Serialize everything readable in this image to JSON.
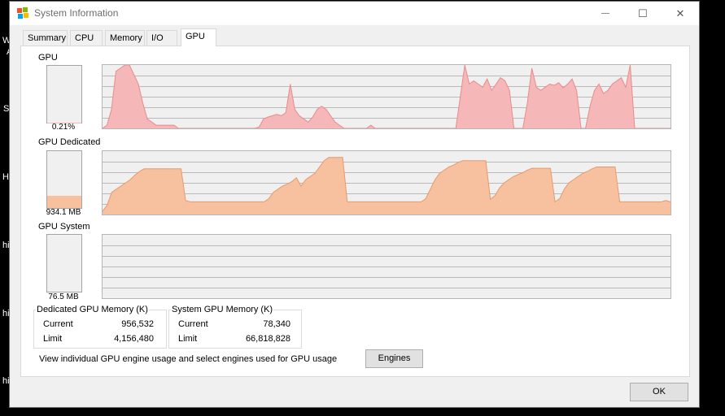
{
  "background_fragments": [
    "W",
    "A",
    "S",
    "H",
    "hi",
    "hi",
    "hi"
  ],
  "window": {
    "title": "System Information",
    "minimize_glyph": "—",
    "maximize_glyph": "☐",
    "close_glyph": "✕"
  },
  "tabs": [
    {
      "label": "Summary"
    },
    {
      "label": "CPU"
    },
    {
      "label": "Memory"
    },
    {
      "label": "I/O"
    },
    {
      "label": "GPU",
      "active": true
    }
  ],
  "sections": {
    "gpu": {
      "label": "GPU",
      "meter_value": "0.21%",
      "meter_fraction": 0.0021
    },
    "gpu_dedicated": {
      "label": "GPU Dedicated",
      "meter_value": "934.1 MB",
      "meter_fraction": 0.22
    },
    "gpu_system": {
      "label": "GPU System",
      "meter_value": "76.5 MB",
      "meter_fraction": 0.0
    }
  },
  "dedicated_memory": {
    "title": "Dedicated GPU Memory (K)",
    "current_label": "Current",
    "current": "956,532",
    "limit_label": "Limit",
    "limit": "4,156,480"
  },
  "system_memory": {
    "title": "System GPU Memory (K)",
    "current_label": "Current",
    "current": "78,340",
    "limit_label": "Limit",
    "limit": "66,818,828"
  },
  "engines_text": "View individual GPU engine usage and select engines used for GPU usage",
  "engines_button": "Engines",
  "ok_button": "OK",
  "colors": {
    "gpu_fill": "#f5b7b7",
    "gpu_line": "#e88c8c",
    "dedicated_fill": "#f7c09f",
    "dedicated_line": "#e59a6e",
    "graph_bg": "#f0f0f0",
    "grid": "#b9b9b9"
  },
  "graphs": {
    "gpu": [
      0,
      5,
      30,
      90,
      95,
      100,
      100,
      85,
      70,
      40,
      15,
      10,
      5,
      5,
      5,
      5,
      5,
      0,
      0,
      0,
      0,
      0,
      0,
      0,
      0,
      0,
      0,
      0,
      0,
      0,
      0,
      0,
      0,
      0,
      0,
      2,
      15,
      18,
      20,
      22,
      20,
      25,
      70,
      30,
      20,
      15,
      10,
      18,
      30,
      35,
      30,
      20,
      10,
      5,
      0,
      0,
      0,
      0,
      0,
      0,
      5,
      0,
      0,
      0,
      0,
      0,
      0,
      0,
      0,
      0,
      0,
      0,
      0,
      0,
      0,
      0,
      0,
      0,
      0,
      0,
      50,
      100,
      70,
      75,
      70,
      65,
      78,
      60,
      70,
      80,
      75,
      60,
      0,
      0,
      0,
      40,
      95,
      65,
      60,
      65,
      70,
      68,
      72,
      64,
      70,
      78,
      60,
      0,
      0,
      35,
      60,
      70,
      55,
      60,
      70,
      75,
      80,
      65,
      100,
      0,
      0,
      0,
      0,
      0,
      0,
      0,
      0,
      0
    ],
    "gpu_dedicated": [
      5,
      15,
      35,
      40,
      45,
      50,
      55,
      62,
      68,
      72,
      72,
      72,
      72,
      72,
      72,
      72,
      72,
      72,
      22,
      20,
      20,
      20,
      20,
      20,
      20,
      20,
      20,
      20,
      20,
      20,
      20,
      20,
      20,
      20,
      20,
      20,
      25,
      35,
      40,
      45,
      48,
      52,
      58,
      45,
      55,
      60,
      65,
      75,
      85,
      90,
      90,
      90,
      90,
      20,
      20,
      20,
      20,
      20,
      20,
      20,
      20,
      20,
      20,
      20,
      20,
      20,
      20,
      20,
      20,
      20,
      25,
      40,
      55,
      65,
      70,
      75,
      78,
      82,
      85,
      85,
      85,
      85,
      85,
      85,
      24,
      30,
      42,
      50,
      55,
      60,
      63,
      66,
      70,
      73,
      73,
      73,
      73,
      73,
      20,
      25,
      40,
      50,
      55,
      60,
      65,
      68,
      72,
      75,
      75,
      75,
      75,
      75,
      20,
      20,
      20,
      20,
      20,
      20,
      20,
      20,
      20,
      20,
      22,
      20
    ]
  }
}
